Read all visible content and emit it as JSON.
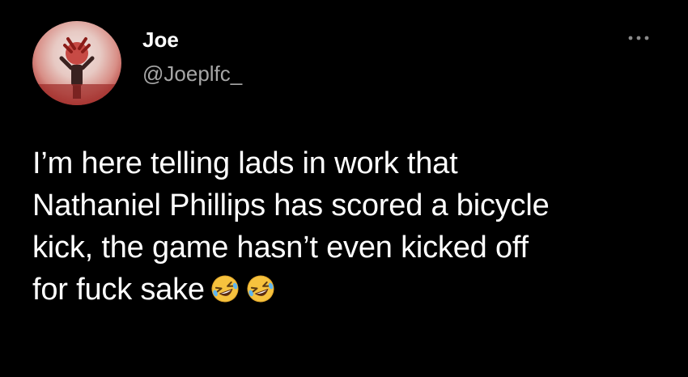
{
  "author": {
    "display_name": "Joe",
    "handle": "@Joeplfc_"
  },
  "avatar": {
    "icon": "profile-avatar"
  },
  "menu": {
    "icon": "more-options-icon"
  },
  "tweet": {
    "lines": [
      "I’m here telling lads in work that",
      "Nathaniel Phillips has scored a bicycle",
      "kick, the game hasn’t even kicked off",
      "for fuck sake"
    ],
    "emojis": [
      "rolling-on-floor-laughing",
      "rolling-on-floor-laughing"
    ]
  },
  "colors": {
    "background": "#000000",
    "text": "#ffffff",
    "handle": "#a6a6a6",
    "emoji_face": "#f6c23e"
  }
}
